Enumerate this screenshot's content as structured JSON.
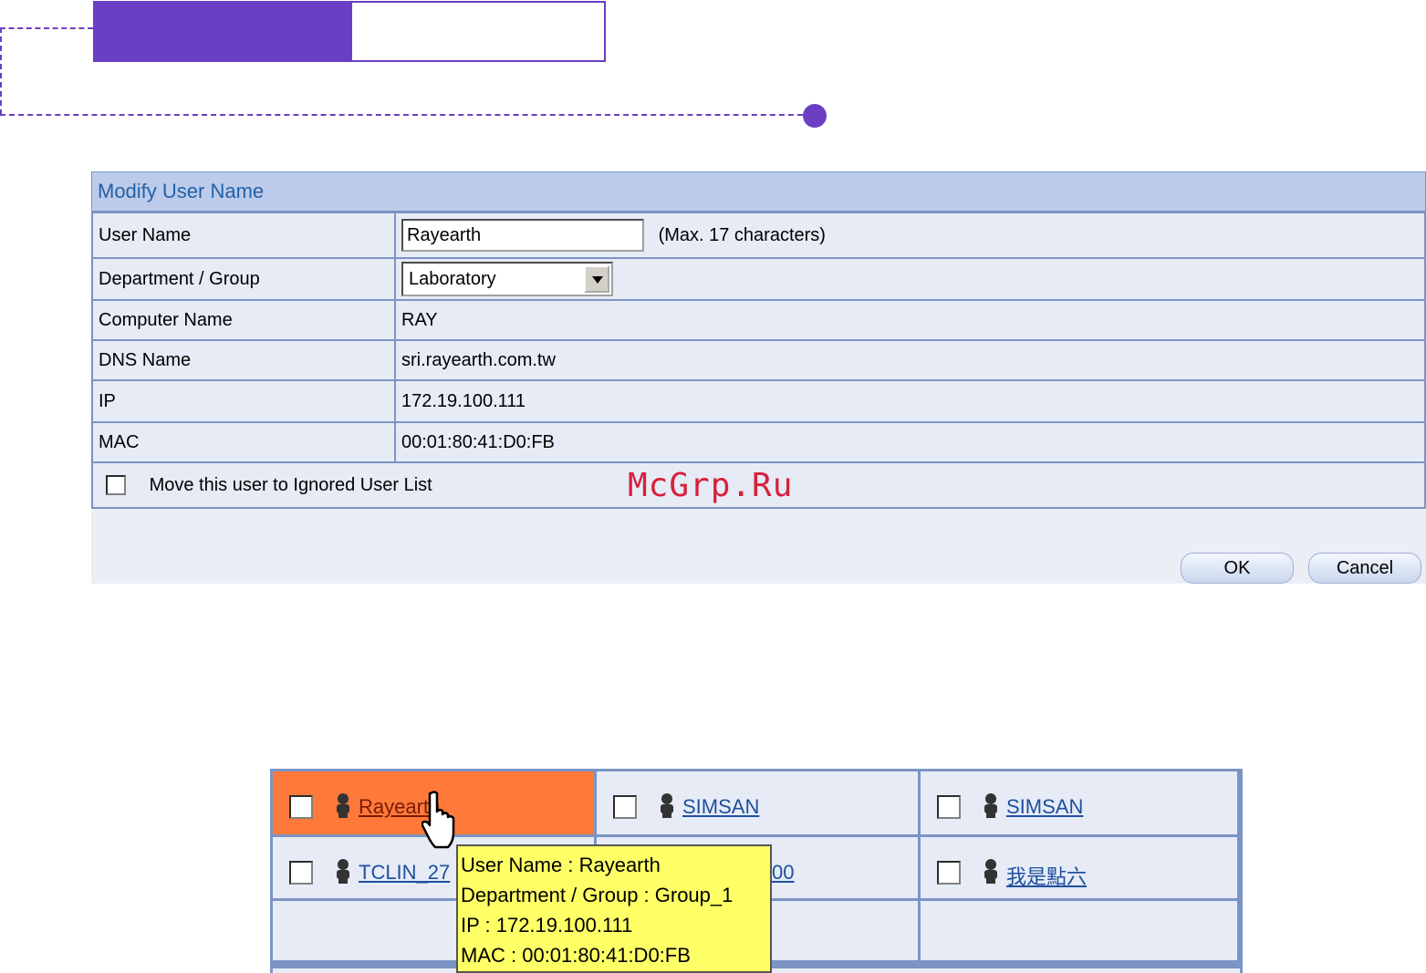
{
  "dialog": {
    "title": "Modify User Name",
    "fields": {
      "user_name_label": "User Name",
      "user_name_value": "Rayearth",
      "user_name_hint": "(Max. 17 characters)",
      "dept_label": "Department / Group",
      "dept_selected": "Laboratory",
      "computer_label": "Computer Name",
      "computer_value": "RAY",
      "dns_label": "DNS Name",
      "dns_value": "sri.rayearth.com.tw",
      "ip_label": "IP",
      "ip_value": "172.19.100.111",
      "mac_label": "MAC",
      "mac_value": "00:01:80:41:D0:FB",
      "move_label": "Move this user to Ignored User List"
    },
    "buttons": {
      "ok": "OK",
      "cancel": "Cancel"
    }
  },
  "watermark": "McGrp.Ru",
  "user_grid": {
    "cells": [
      {
        "name": "Rayearth"
      },
      {
        "name": "SIMSAN"
      },
      {
        "name": "SIMSAN"
      },
      {
        "name": "TCLIN_27"
      },
      {
        "name": "00"
      },
      {
        "name": "我是點六"
      }
    ]
  },
  "tooltip": {
    "line1": "User Name : Rayearth",
    "line2": "Department / Group : Group_1",
    "line3": "IP : 172.19.100.111",
    "line4": "MAC : 00:01:80:41:D0:FB"
  },
  "colors": {
    "accent": "#6a3fc4",
    "highlight": "#ff7a3a",
    "tooltip": "#ffff66",
    "border": "#7b94c4"
  }
}
